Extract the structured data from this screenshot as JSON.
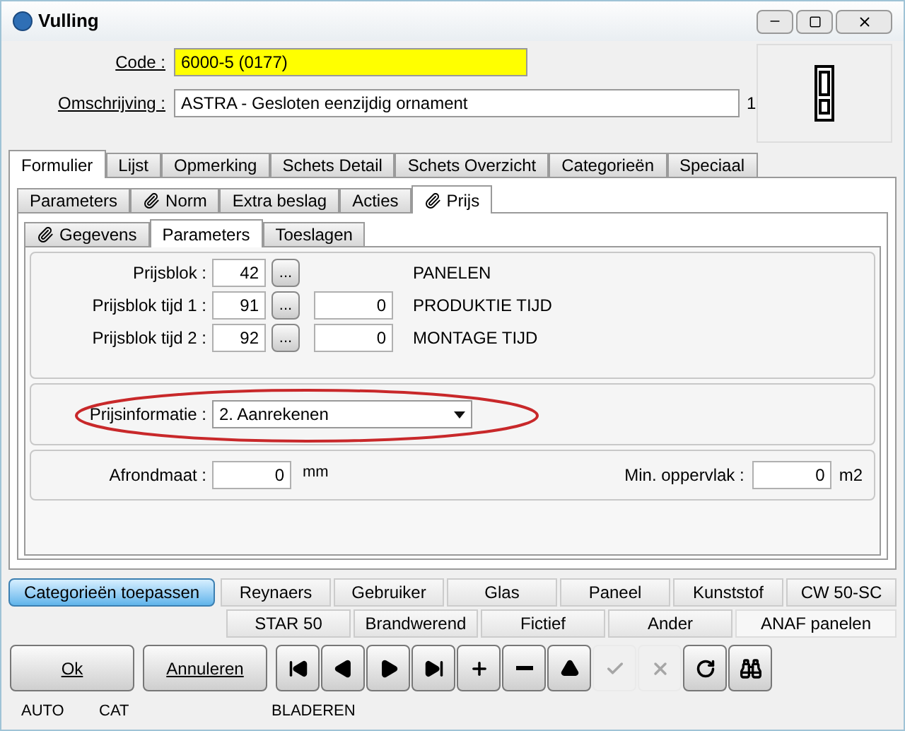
{
  "window": {
    "title": "Vulling"
  },
  "code": {
    "label": "Code :",
    "value": "6000-5 (0177)"
  },
  "omschrijving": {
    "label": "Omschrijving :",
    "value": "ASTRA - Gesloten eenzijdig ornament",
    "count": "1"
  },
  "main_tabs": [
    {
      "label": "Formulier",
      "selected": true
    },
    {
      "label": "Lijst",
      "selected": false
    },
    {
      "label": "Opmerking",
      "selected": false
    },
    {
      "label": "Schets Detail",
      "selected": false
    },
    {
      "label": "Schets Overzicht",
      "selected": false
    },
    {
      "label": "Categorieën",
      "selected": false
    },
    {
      "label": "Speciaal",
      "selected": false
    }
  ],
  "sub_tabs": [
    {
      "label": "Parameters",
      "selected": false,
      "clip": false
    },
    {
      "label": "Norm",
      "selected": false,
      "clip": true
    },
    {
      "label": "Extra beslag",
      "selected": false,
      "clip": false
    },
    {
      "label": "Acties",
      "selected": false,
      "clip": false
    },
    {
      "label": "Prijs",
      "selected": true,
      "clip": true
    }
  ],
  "price_tabs": [
    {
      "label": "Gegevens",
      "selected": false,
      "clip": true
    },
    {
      "label": "Parameters",
      "selected": true,
      "clip": false
    },
    {
      "label": "Toeslagen",
      "selected": false,
      "clip": false
    }
  ],
  "price_blocks": [
    {
      "label": "Prijsblok :",
      "value": "42",
      "description": "PANELEN"
    },
    {
      "label": "Prijsblok tijd 1 :",
      "value": "91",
      "time": "0",
      "description": "PRODUKTIE TIJD"
    },
    {
      "label": "Prijsblok tijd 2 :",
      "value": "92",
      "time": "0",
      "description": "MONTAGE TIJD"
    }
  ],
  "browse_button": "...",
  "prijsinformatie": {
    "label": "Prijsinformatie :",
    "value": "2.  Aanrekenen",
    "circled": true
  },
  "afrondmaat": {
    "label": "Afrondmaat :",
    "value": "0",
    "unit": "mm"
  },
  "min_oppervlak": {
    "label": "Min. oppervlak :",
    "value": "0",
    "unit": "m2"
  },
  "apply_button": {
    "label": "Categorieën toepassen",
    "on": true
  },
  "category_rows": [
    [
      {
        "label": "Reynaers",
        "selected": false
      },
      {
        "label": "Gebruiker",
        "selected": false
      },
      {
        "label": "Glas",
        "selected": false
      },
      {
        "label": "Paneel",
        "selected": false
      },
      {
        "label": "Kunststof",
        "selected": false
      },
      {
        "label": "CW 50-SC",
        "selected": false
      }
    ],
    [
      {
        "label": "STAR 50",
        "selected": false
      },
      {
        "label": "Brandwerend",
        "selected": false
      },
      {
        "label": "Fictief",
        "selected": false
      },
      {
        "label": "Ander",
        "selected": false
      },
      {
        "label": "ANAF panelen",
        "selected": true
      }
    ]
  ],
  "buttons": [
    {
      "label": "Ok"
    },
    {
      "label": "Annuleren"
    }
  ],
  "nav_buttons": [
    {
      "kind": "first",
      "disabled": false
    },
    {
      "kind": "prev",
      "disabled": false
    },
    {
      "kind": "next",
      "disabled": false
    },
    {
      "kind": "last",
      "disabled": false
    },
    {
      "kind": "add",
      "disabled": false
    },
    {
      "kind": "delete",
      "disabled": false
    },
    {
      "kind": "up",
      "disabled": false
    },
    {
      "kind": "confirm",
      "disabled": true
    },
    {
      "kind": "cancel",
      "disabled": true
    },
    {
      "kind": "refresh",
      "disabled": false
    },
    {
      "kind": "find",
      "disabled": false
    }
  ],
  "status_bar": [
    "AUTO",
    "CAT",
    "BLADEREN"
  ]
}
